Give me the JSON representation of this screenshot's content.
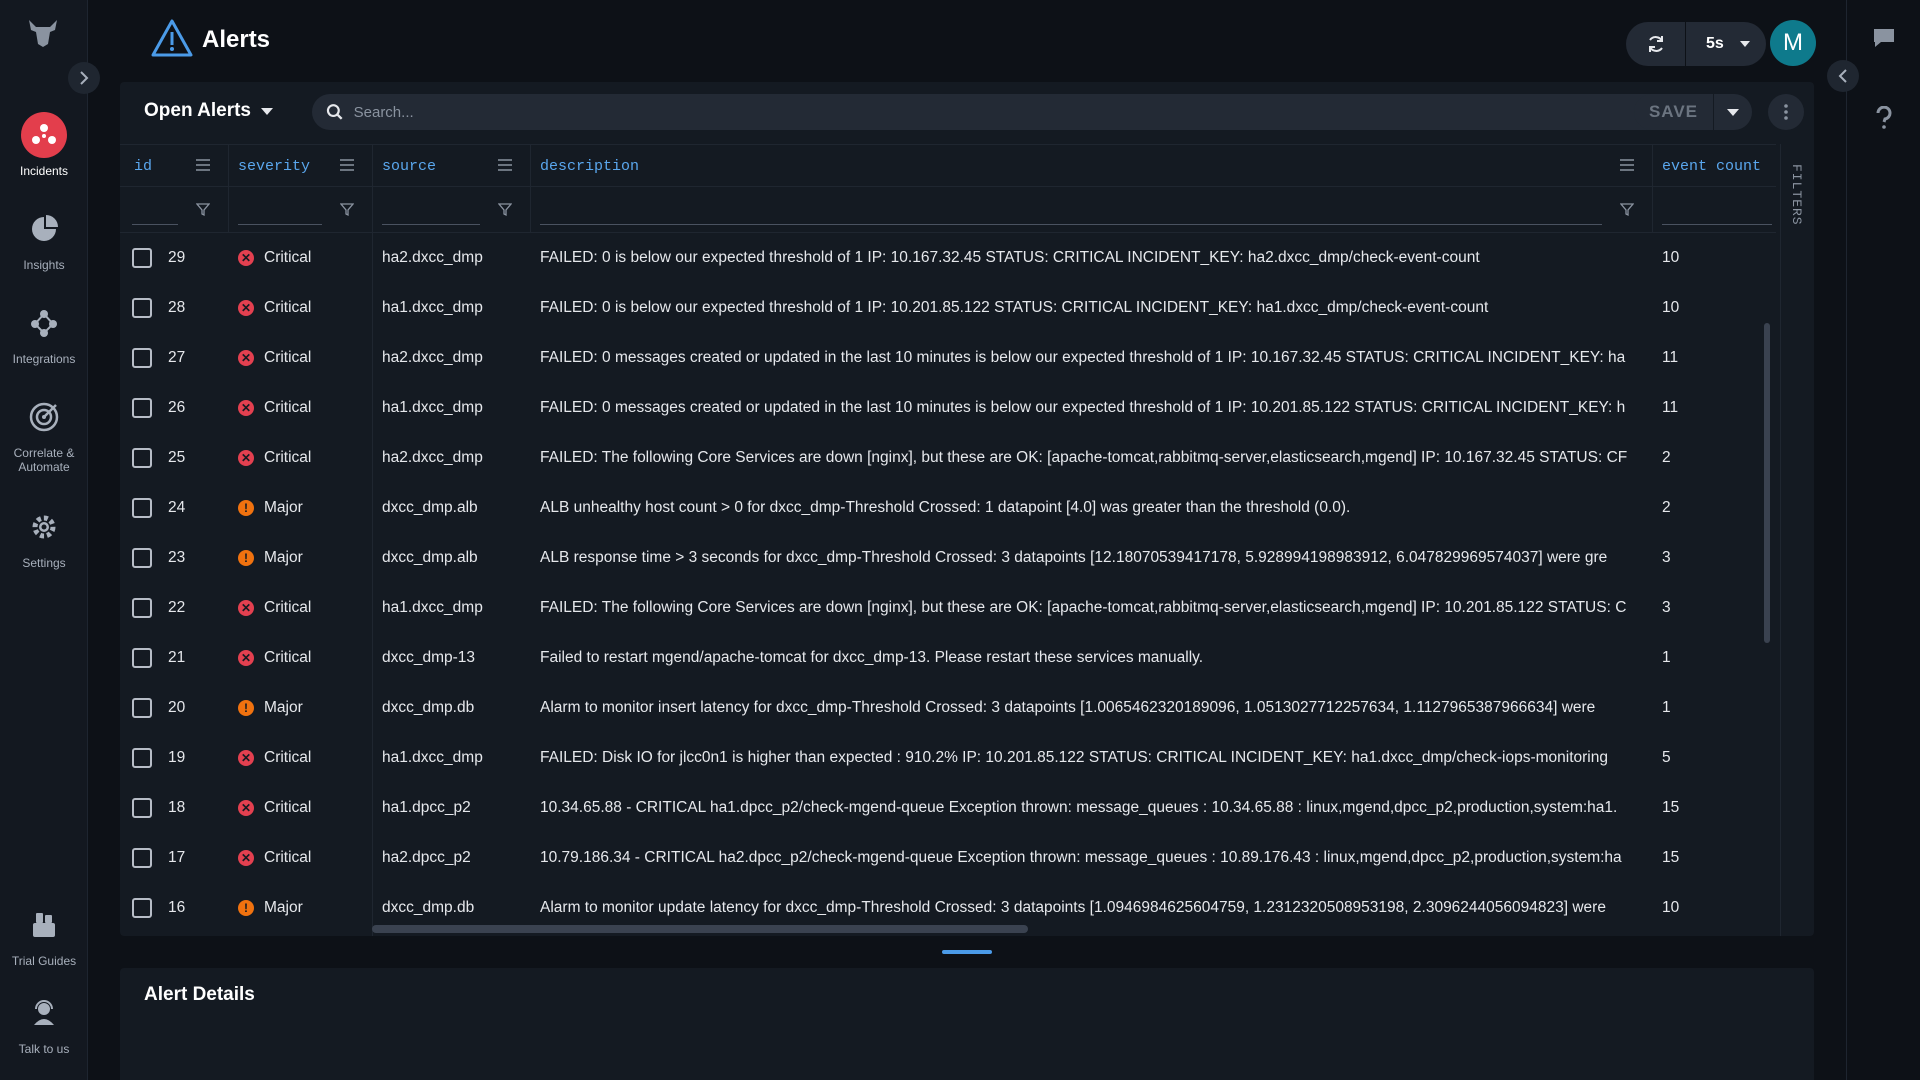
{
  "nav": {
    "items": [
      {
        "label": "Incidents",
        "icon": "incidents-icon",
        "active": true
      },
      {
        "label": "Insights",
        "icon": "pie-chart-icon"
      },
      {
        "label": "Integrations",
        "icon": "integrations-icon"
      },
      {
        "label": "Correlate &\nAutomate",
        "icon": "target-icon"
      },
      {
        "label": "Settings",
        "icon": "gear-icon"
      }
    ],
    "bottom": [
      {
        "label": "Trial Guides",
        "icon": "guides-icon"
      },
      {
        "label": "Talk to us",
        "icon": "support-icon"
      }
    ]
  },
  "header": {
    "title": "Alerts",
    "refresh_interval": "5s",
    "avatar_initial": "M"
  },
  "toolbar": {
    "view": "Open Alerts",
    "search_placeholder": "Search...",
    "save_label": "SAVE"
  },
  "table": {
    "columns": {
      "id": "id",
      "severity": "severity",
      "source": "source",
      "description": "description",
      "event_count": "event count"
    },
    "filters_tab": "FILTERS",
    "rows": [
      {
        "id": "29",
        "severity": "Critical",
        "source": "ha2.dxcc_dmp",
        "description": "FAILED: 0 is below our expected threshold of 1 IP: 10.167.32.45 STATUS: CRITICAL INCIDENT_KEY: ha2.dxcc_dmp/check-event-count",
        "count": "10"
      },
      {
        "id": "28",
        "severity": "Critical",
        "source": "ha1.dxcc_dmp",
        "description": "FAILED: 0 is below our expected threshold of 1 IP: 10.201.85.122 STATUS: CRITICAL INCIDENT_KEY: ha1.dxcc_dmp/check-event-count",
        "count": "10"
      },
      {
        "id": "27",
        "severity": "Critical",
        "source": "ha2.dxcc_dmp",
        "description": "FAILED: 0 messages created or updated in the last 10 minutes is below our expected threshold of 1 IP: 10.167.32.45 STATUS: CRITICAL INCIDENT_KEY: ha",
        "count": "11"
      },
      {
        "id": "26",
        "severity": "Critical",
        "source": "ha1.dxcc_dmp",
        "description": "FAILED: 0 messages created or updated in the last 10 minutes is below our expected threshold of 1 IP: 10.201.85.122 STATUS: CRITICAL INCIDENT_KEY: h",
        "count": "11"
      },
      {
        "id": "25",
        "severity": "Critical",
        "source": "ha2.dxcc_dmp",
        "description": "FAILED: The following Core Services are down [nginx], but these are OK: [apache-tomcat,rabbitmq-server,elasticsearch,mgend] IP: 10.167.32.45 STATUS: CF",
        "count": "2"
      },
      {
        "id": "24",
        "severity": "Major",
        "source": "dxcc_dmp.alb",
        "description": "ALB unhealthy host count > 0 for dxcc_dmp-Threshold Crossed: 1 datapoint [4.0] was greater than the threshold (0.0).",
        "count": "2"
      },
      {
        "id": "23",
        "severity": "Major",
        "source": "dxcc_dmp.alb",
        "description": "ALB response time > 3 seconds for dxcc_dmp-Threshold Crossed: 3 datapoints [12.18070539417178, 5.928994198983912, 6.047829969574037] were gre",
        "count": "3"
      },
      {
        "id": "22",
        "severity": "Critical",
        "source": "ha1.dxcc_dmp",
        "description": "FAILED: The following Core Services are down [nginx], but these are OK: [apache-tomcat,rabbitmq-server,elasticsearch,mgend] IP: 10.201.85.122 STATUS: C",
        "count": "3"
      },
      {
        "id": "21",
        "severity": "Critical",
        "source": "dxcc_dmp-13",
        "description": "Failed to restart mgend/apache-tomcat for dxcc_dmp-13. Please restart these services manually.",
        "count": "1"
      },
      {
        "id": "20",
        "severity": "Major",
        "source": "dxcc_dmp.db",
        "description": "Alarm to monitor insert latency for dxcc_dmp-Threshold Crossed: 3 datapoints [1.0065462320189096, 1.0513027712257634, 1.1127965387966634] were",
        "count": "1"
      },
      {
        "id": "19",
        "severity": "Critical",
        "source": "ha1.dxcc_dmp",
        "description": "FAILED: Disk IO for jlcc0n1 is higher than expected : 910.2% IP: 10.201.85.122 STATUS: CRITICAL INCIDENT_KEY: ha1.dxcc_dmp/check-iops-monitoring",
        "count": "5"
      },
      {
        "id": "18",
        "severity": "Critical",
        "source": "ha1.dpcc_p2",
        "description": "10.34.65.88 - CRITICAL ha1.dpcc_p2/check-mgend-queue Exception thrown: message_queues : 10.34.65.88 : linux,mgend,dpcc_p2,production,system:ha1.",
        "count": "15"
      },
      {
        "id": "17",
        "severity": "Critical",
        "source": "ha2.dpcc_p2",
        "description": "10.79.186.34 - CRITICAL ha2.dpcc_p2/check-mgend-queue Exception thrown: message_queues : 10.89.176.43 : linux,mgend,dpcc_p2,production,system:ha",
        "count": "15"
      },
      {
        "id": "16",
        "severity": "Major",
        "source": "dxcc_dmp.db",
        "description": "Alarm to monitor update latency for dxcc_dmp-Threshold Crossed: 3 datapoints [1.0946984625604759, 1.2312320508953198, 2.3096244056094823] were",
        "count": "10"
      }
    ]
  },
  "details": {
    "title": "Alert Details"
  },
  "colors": {
    "critical": "#e34050",
    "major": "#f0720f",
    "accent": "#5aa7ee",
    "active_nav": "#e33e4c"
  }
}
